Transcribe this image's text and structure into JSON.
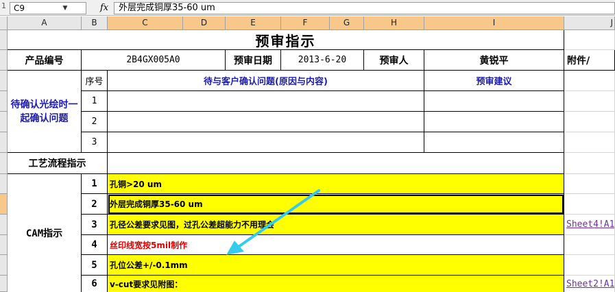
{
  "formula_bar": {
    "left_mark": "1",
    "name_box": "C9",
    "fx_label": "fx",
    "formula": "外层完成铜厚35-60 um"
  },
  "columns": [
    "A",
    "B",
    "C",
    "D",
    "E",
    "F",
    "G",
    "H",
    "I",
    "J"
  ],
  "sheet": {
    "title": "预审指示",
    "product_no_label": "产品编号",
    "product_no": "2B4GX005A0",
    "review_date_label": "预审日期",
    "review_date": "2013-6-20",
    "reviewer_label": "预审人",
    "reviewer": "黄锐平",
    "attachment_label": "附件/",
    "pending_label": "待确认光绘时一起确认问题",
    "seq_label": "序号",
    "issues_label": "待与客户确认问题(原因与内容)",
    "suggestion_label": "预审建议",
    "pending_rows": [
      "1",
      "2",
      "3"
    ],
    "process_label": "工艺流程指示",
    "cam_label": "CAM指示",
    "cam_rows": [
      {
        "no": "1",
        "text": "孔铜>20 um",
        "link": ""
      },
      {
        "no": "2",
        "text": "外层完成铜厚35-60 um",
        "link": ""
      },
      {
        "no": "3",
        "text": "孔径公差要求见图，过孔公差超能力不用理会",
        "link": "Sheet4!A1"
      },
      {
        "no": "4",
        "text": "丝印线宽按5mil制作",
        "link": ""
      },
      {
        "no": "5",
        "text": "孔位公差+/-0.1mm",
        "link": ""
      },
      {
        "no": "6",
        "text": "v-cut要求见附图：",
        "link": "Sheet2!A1"
      }
    ]
  },
  "colors": {
    "highlight": "#ffff00",
    "header_selected": "#f8c88a",
    "arrow": "#33ccee",
    "label_blue": "#1b1bb0",
    "warn_red": "#e00000"
  }
}
